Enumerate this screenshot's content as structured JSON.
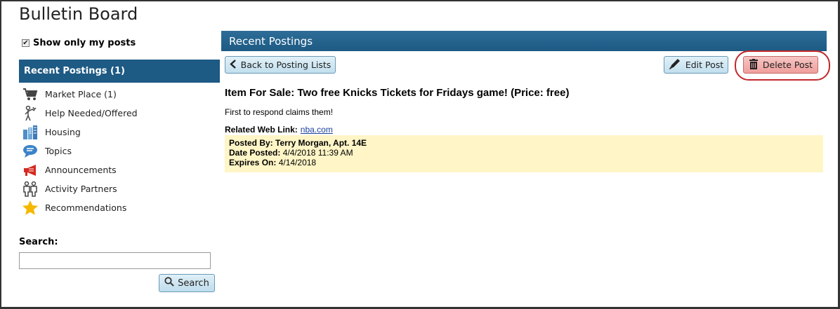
{
  "page": {
    "title": "Bulletin Board"
  },
  "sidebar": {
    "show_mine_label": "Show only my posts",
    "show_mine_checked": true,
    "header": "Recent Postings (1)",
    "items": [
      {
        "label": "Market Place (1)",
        "icon": "cart-icon"
      },
      {
        "label": "Help Needed/Offered",
        "icon": "helping-person-icon"
      },
      {
        "label": "Housing",
        "icon": "buildings-icon"
      },
      {
        "label": "Topics",
        "icon": "speech-bubble-icon"
      },
      {
        "label": "Announcements",
        "icon": "megaphone-icon"
      },
      {
        "label": "Activity Partners",
        "icon": "people-icon"
      },
      {
        "label": "Recommendations",
        "icon": "star-icon"
      }
    ],
    "search": {
      "label": "Search:",
      "value": "",
      "button": "Search"
    }
  },
  "main": {
    "header": "Recent Postings",
    "back_button": "Back to Posting Lists",
    "edit_button": "Edit Post",
    "delete_button": "Delete Post",
    "post": {
      "title": "Item For Sale: Two free Knicks Tickets for Fridays game! (Price: free)",
      "description": "First to respond claims them!",
      "link_label": "Related Web Link:",
      "link_text": "nba.com",
      "posted_by_label": "Posted By:",
      "posted_by": "Terry Morgan, Apt. 14E",
      "date_posted_label": "Date Posted:",
      "date_posted": "4/4/2018 11:39 AM",
      "expires_label": "Expires On:",
      "expires": "4/14/2018"
    }
  },
  "colors": {
    "header_blue": "#1d5a84",
    "meta_bg": "#fff5c6",
    "delete_red": "#ef9f9c",
    "highlight_ring": "#c0282b"
  }
}
